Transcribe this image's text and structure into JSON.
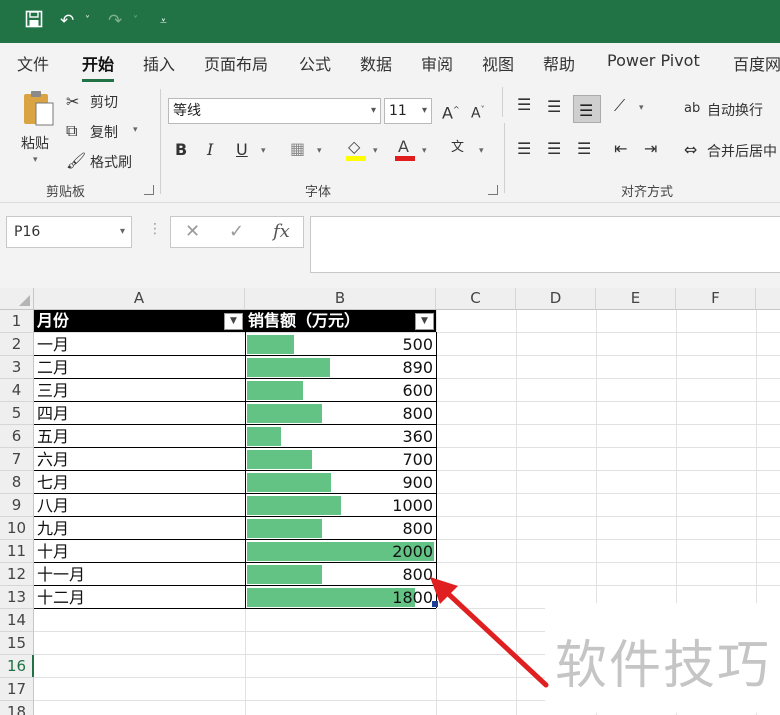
{
  "quick_access": {
    "save_icon": "save-icon",
    "undo_icon": "undo-icon",
    "redo_icon": "redo-icon",
    "customize_icon": "customize-qat-icon"
  },
  "tabs": [
    "文件",
    "开始",
    "插入",
    "页面布局",
    "公式",
    "数据",
    "审阅",
    "视图",
    "帮助",
    "Power Pivot",
    "百度网"
  ],
  "active_tab": "开始",
  "ribbon": {
    "clipboard": {
      "paste": "粘贴",
      "cut": "剪切",
      "copy": "复制",
      "format_painter": "格式刷",
      "group": "剪贴板"
    },
    "font": {
      "font_name": "等线",
      "font_size": "11",
      "bold": "B",
      "italic": "I",
      "underline": "U",
      "font_color_letter": "A",
      "group": "字体",
      "grow": "A",
      "shrink": "A"
    },
    "alignment": {
      "wrap_text": "自动换行",
      "merge_center": "合并后居中",
      "group": "对齐方式"
    }
  },
  "formula_bar": {
    "name_box": "P16",
    "cancel": "✕",
    "enter": "✓",
    "fx": "fx",
    "formula": ""
  },
  "sheet": {
    "columns": [
      "A",
      "B",
      "C",
      "D",
      "E",
      "F"
    ],
    "rows": [
      "1",
      "2",
      "3",
      "4",
      "5",
      "6",
      "7",
      "8",
      "9",
      "10",
      "11",
      "12",
      "13",
      "14",
      "15",
      "16",
      "17",
      "18"
    ],
    "selected_row": "16",
    "table_headers": [
      "月份",
      "销售额（万元）"
    ],
    "data": [
      {
        "month": "一月",
        "sales": "500"
      },
      {
        "month": "二月",
        "sales": "890"
      },
      {
        "month": "三月",
        "sales": "600"
      },
      {
        "month": "四月",
        "sales": "800"
      },
      {
        "month": "五月",
        "sales": "360"
      },
      {
        "month": "六月",
        "sales": "700"
      },
      {
        "month": "七月",
        "sales": "900"
      },
      {
        "month": "八月",
        "sales": "1000"
      },
      {
        "month": "九月",
        "sales": "800"
      },
      {
        "month": "十月",
        "sales": "2000"
      },
      {
        "month": "十一月",
        "sales": "800"
      },
      {
        "month": "十二月",
        "sales": "1800"
      }
    ],
    "data_bar_color": "#63c384",
    "data_bar_max": 2000
  },
  "watermark": "软件技巧",
  "accent_color": "#217346",
  "annotation_arrow_color": "#e02020"
}
